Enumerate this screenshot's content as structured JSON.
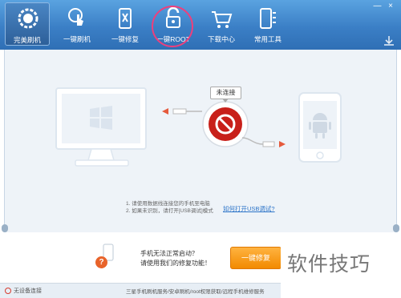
{
  "toolbar": {
    "items": [
      {
        "label": "完美刷机",
        "icon": "android-gear-icon",
        "active": true
      },
      {
        "label": "一键刷机",
        "icon": "touch-hand-icon",
        "active": false
      },
      {
        "label": "一键修复",
        "icon": "phone-wrench-icon",
        "active": false
      },
      {
        "label": "一键ROOT",
        "icon": "unlock-icon",
        "active": false
      },
      {
        "label": "下载中心",
        "icon": "cart-icon",
        "active": false
      },
      {
        "label": "常用工具",
        "icon": "phone-tools-icon",
        "active": false
      }
    ],
    "window_controls": [
      "—",
      "×"
    ]
  },
  "main": {
    "connection_status": "未连接",
    "hint_line1": "1. 请使用数据线连接您的手机至电脑",
    "hint_line2": "2. 如果未识别，请打开[USB调试]模式",
    "usb_link": "如何打开USB调试?"
  },
  "repair": {
    "title": "手机无法正常启动？",
    "subtitle": "请使用我们的修复功能！",
    "button": "一键修复"
  },
  "status": {
    "device": "无设备连接",
    "footer": "三星手机刷机服务/安卓刷机/root权限获取/远程手机维修服务"
  },
  "watermark": "软件技巧",
  "colors": {
    "toolbar": "#3b7fc6",
    "accent": "#f28a00",
    "stop": "#c8201a",
    "highlight": "#ee3f7c"
  }
}
